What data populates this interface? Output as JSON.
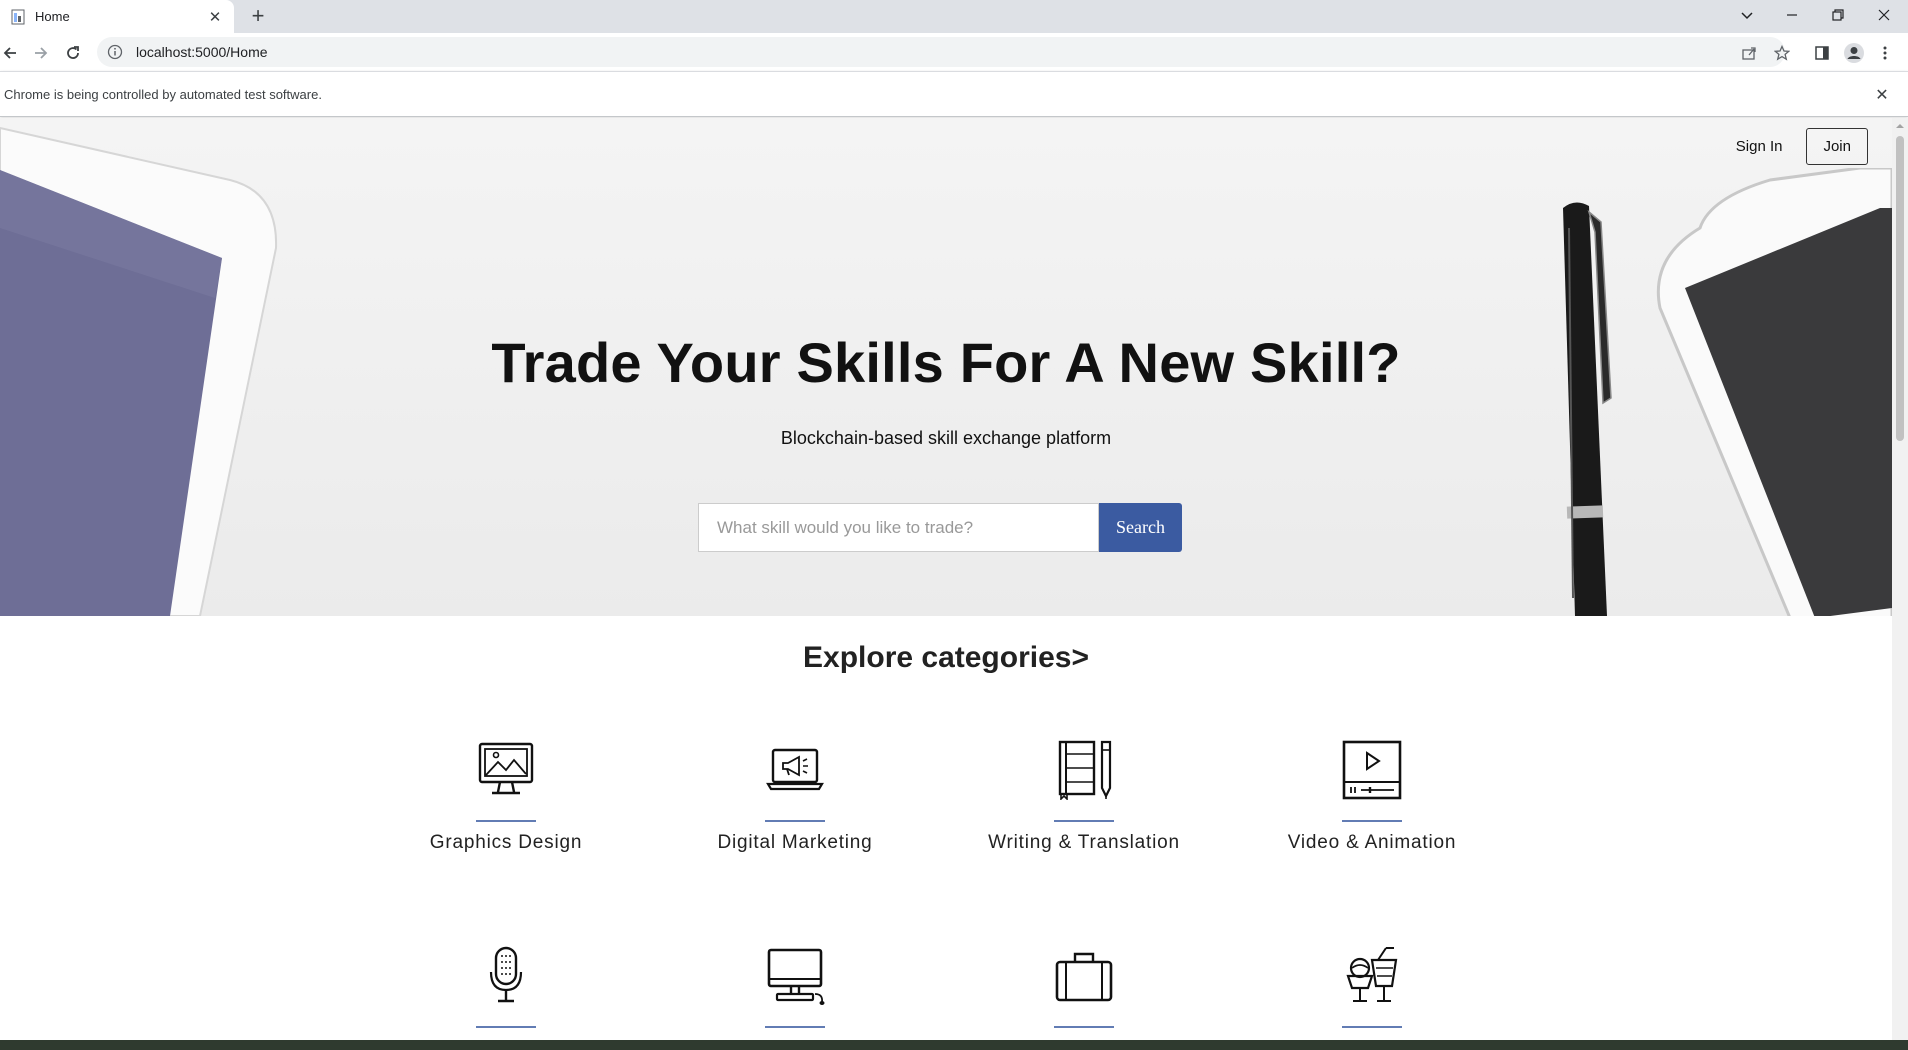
{
  "browser": {
    "tab_title": "Home",
    "url": "localhost:5000/Home",
    "infobar_text": "Chrome is being controlled by automated test software."
  },
  "header": {
    "signin_label": "Sign In",
    "join_label": "Join"
  },
  "hero": {
    "title": "Trade Your Skills For A New Skill?",
    "subtitle": "Blockchain-based skill exchange platform",
    "search_placeholder": "What skill would you like to trade?",
    "search_button": "Search"
  },
  "categories": {
    "heading": "Explore categories>",
    "items": [
      {
        "label": "Graphics Design",
        "icon": "monitor-image-icon"
      },
      {
        "label": "Digital Marketing",
        "icon": "laptop-megaphone-icon"
      },
      {
        "label": "Writing & Translation",
        "icon": "notebook-pencil-icon"
      },
      {
        "label": "Video & Animation",
        "icon": "video-player-icon"
      },
      {
        "label": "",
        "icon": "microphone-icon"
      },
      {
        "label": "",
        "icon": "desktop-computer-icon"
      },
      {
        "label": "",
        "icon": "briefcase-icon"
      },
      {
        "label": "",
        "icon": "drinks-icon"
      }
    ]
  },
  "colors": {
    "accent": "#3b5ba1",
    "tabstrip": "#dee1e6"
  }
}
